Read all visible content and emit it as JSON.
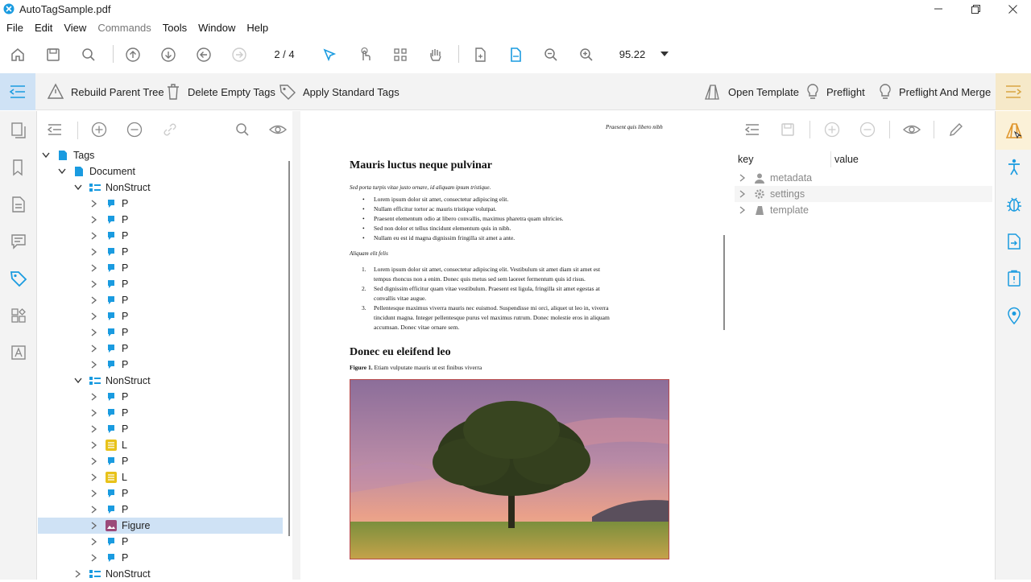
{
  "window": {
    "title": "AutoTagSample.pdf"
  },
  "menu": [
    "File",
    "Edit",
    "View",
    "Commands",
    "Tools",
    "Window",
    "Help"
  ],
  "toolbar": {
    "page_indicator": "2 / 4",
    "zoom": "95.22"
  },
  "tagbar": {
    "rebuild": "Rebuild Parent Tree",
    "delete_empty": "Delete Empty Tags",
    "apply_standard": "Apply Standard Tags",
    "open_template": "Open Template",
    "preflight": "Preflight",
    "preflight_merge": "Preflight And Merge"
  },
  "tree": {
    "root": "Tags",
    "document": "Document",
    "rows": [
      {
        "label": "NonStruct",
        "type": "ns",
        "level": 2,
        "expanded": true
      },
      {
        "label": "P",
        "type": "p",
        "level": 3
      },
      {
        "label": "P",
        "type": "p",
        "level": 3
      },
      {
        "label": "P",
        "type": "p",
        "level": 3
      },
      {
        "label": "P",
        "type": "p",
        "level": 3
      },
      {
        "label": "P",
        "type": "p",
        "level": 3
      },
      {
        "label": "P",
        "type": "p",
        "level": 3
      },
      {
        "label": "P",
        "type": "p",
        "level": 3
      },
      {
        "label": "P",
        "type": "p",
        "level": 3
      },
      {
        "label": "P",
        "type": "p",
        "level": 3
      },
      {
        "label": "P",
        "type": "p",
        "level": 3
      },
      {
        "label": "P",
        "type": "p",
        "level": 3
      },
      {
        "label": "NonStruct",
        "type": "ns",
        "level": 2,
        "expanded": true
      },
      {
        "label": "P",
        "type": "p",
        "level": 3
      },
      {
        "label": "P",
        "type": "p",
        "level": 3
      },
      {
        "label": "P",
        "type": "p",
        "level": 3
      },
      {
        "label": "L",
        "type": "l",
        "level": 3
      },
      {
        "label": "P",
        "type": "p",
        "level": 3
      },
      {
        "label": "L",
        "type": "l",
        "level": 3
      },
      {
        "label": "P",
        "type": "p",
        "level": 3
      },
      {
        "label": "P",
        "type": "p",
        "level": 3
      },
      {
        "label": "Figure",
        "type": "fig",
        "level": 3,
        "selected": true
      },
      {
        "label": "P",
        "type": "p",
        "level": 3
      },
      {
        "label": "P",
        "type": "p",
        "level": 3
      },
      {
        "label": "NonStruct",
        "type": "ns",
        "level": 2,
        "expanded": false
      }
    ]
  },
  "document": {
    "header": "Praesent quis libero nibh",
    "h1": "Mauris luctus neque pulvinar",
    "intro": "Sed porta turpis vitae justo ornare, id aliquam ipsum tristique.",
    "bullets": [
      "Lorem ipsum dolor sit amet, consectetur adipiscing elit.",
      "Nullam efficitur tortor ac mauris tristique volutpat.",
      "Praesent elementum odio at libero convallis, maximus pharetra quam ultricies.",
      "Sed non dolor et tellus tincidunt elementum quis in nibh.",
      "Nullam eu est id magna dignissim fringilla sit amet a ante."
    ],
    "sub": "Aliquam elit felis",
    "numbered": [
      [
        "1.",
        "Lorem ipsum dolor sit amet, consectetur adipiscing elit. Vestibulum sit amet diam sit amet est",
        "tempus rhoncus non a enim. Donec quis metus sed sem laoreet fermentum quis id risus."
      ],
      [
        "2.",
        "Sed dignissim efficitur quam vitae vestibulum. Praesent est ligula, fringilla sit amet egestas at",
        "convallis vitae augue."
      ],
      [
        "3.",
        "Pellentesque maximus viverra mauris nec euismod. Suspendisse mi orci, aliquet ut leo in, viverra",
        "tincidunt magna. Integer pellentesque purus vel maximus rutrum. Donec molestie eros in aliquam",
        "accumsan. Donec vitae ornare sem."
      ]
    ],
    "h2": "Donec eu eleifend leo",
    "caption_label": "Figure 1.",
    "caption_text": "Etiam vulputate mauris ut est finibus viverra"
  },
  "properties": {
    "key_header": "key",
    "value_header": "value",
    "rows": [
      "metadata",
      "settings",
      "template"
    ]
  },
  "colors": {
    "accent": "#1a9be0",
    "selected": "#cfe2f5",
    "paragraph_icon": "#1a9be0",
    "list_icon": "#e8c21a",
    "figure_icon": "#9b4a7a"
  }
}
